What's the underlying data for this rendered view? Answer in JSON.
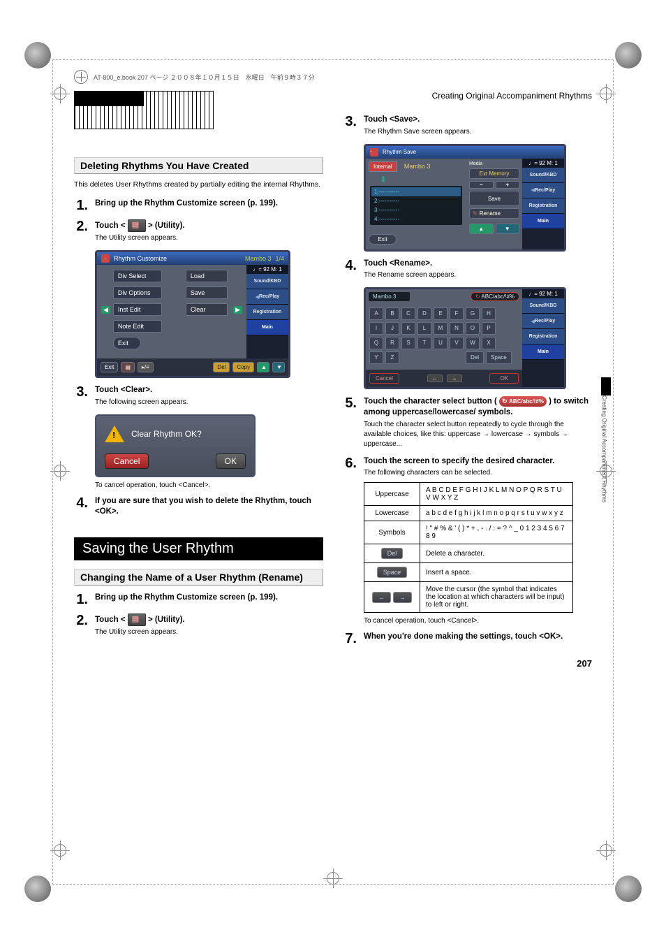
{
  "book_header": "AT-800_e.book  207 ページ  ２００８年１０月１５日　水曜日　午前９時３７分",
  "page_title_right": "Creating Original Accompaniment Rhythms",
  "side_text": "Creating Original Accompaniment Rhythms",
  "page_number": "207",
  "left": {
    "section_bar": "Deleting Rhythms You Have Created",
    "intro": "This deletes User Rhythms created by partially editing the internal Rhythms.",
    "steps": {
      "s1": "Bring up the Rhythm Customize screen (p. 199).",
      "s2_pre": "Touch <",
      "s2_post": "> (Utility).",
      "s2_sub": "The Utility screen appears.",
      "s3": "Touch <Clear>.",
      "s3_sub": "The following screen appears.",
      "cap3": "To cancel operation, touch <Cancel>.",
      "s4": "If you are sure that you wish to delete the Rhythm, touch <OK>."
    },
    "ui": {
      "title": "Rhythm Customize",
      "sub1": "Mambo 3",
      "sub2": "1/4",
      "opts_left": [
        "Div Select",
        "Div Options",
        "Inst Edit",
        "Note Edit"
      ],
      "opts_right": [
        "Load",
        "Save",
        "Clear"
      ],
      "exit_small": "Exit",
      "tempo": "♩= 92  M: 1",
      "rbtns": [
        "Sound/KBD",
        "Rec/Play",
        "Registration",
        "Main"
      ],
      "bottom": {
        "exit": "Exit",
        "del": "Del",
        "copy": "Copy",
        "frac": "▸/≡"
      }
    },
    "dialog": {
      "text": "Clear Rhythm OK?",
      "cancel": "Cancel",
      "ok": "OK"
    },
    "big_section": "Saving the User Rhythm",
    "section_bar2": "Changing the Name of a User Rhythm (Rename)",
    "steps2": {
      "s1": "Bring up the Rhythm Customize screen (p. 199).",
      "s2_pre": "Touch <",
      "s2_post": "> (Utility).",
      "s2_sub": "The Utility screen appears."
    }
  },
  "right": {
    "steps": {
      "s3": "Touch <Save>.",
      "s3_sub": "The Rhythm Save screen appears.",
      "s4": "Touch <Rename>.",
      "s4_sub": "The Rename screen appears.",
      "s5_pre": "Touch the character select button (",
      "s5_label": "ABC/abc/!#%",
      "s5_post": ") to switch among uppercase/lowercase/ symbols.",
      "s5_sub": "Touch the character select button repeatedly to cycle through the available choices, like this: uppercase → lowercase → symbols → uppercase...",
      "s6": "Touch the screen to specify the desired character.",
      "s6_sub": "The following characters can be selected.",
      "cap6": "To cancel operation, touch <Cancel>.",
      "s7": "When you're done making the settings, touch <OK>."
    },
    "save_ui": {
      "title": "Rhythm Save",
      "internal": "Internal",
      "rname": "Mambo 3",
      "media": "Media",
      "mediaval": "Ext Memory",
      "slots": [
        "1:-----------",
        "2:-----------",
        "3:-----------",
        "4:-----------"
      ],
      "save": "Save",
      "rename": "Rename",
      "exit": "Exit",
      "tempo": "♩= 92  M: 1",
      "rbtns": [
        "Sound/KBD",
        "Rec/Play",
        "Registration",
        "Main"
      ]
    },
    "kb": {
      "name": "Mambo 3",
      "mode": "ABC/abc/!#%",
      "rows": [
        [
          "A",
          "B",
          "C",
          "D",
          "E",
          "F",
          "G",
          "H"
        ],
        [
          "I",
          "J",
          "K",
          "L",
          "M",
          "N",
          "O",
          "P"
        ],
        [
          "Q",
          "R",
          "S",
          "T",
          "U",
          "V",
          "W",
          "X"
        ],
        [
          "Y",
          "Z",
          "",
          "",
          "",
          "",
          "Del",
          "Space"
        ]
      ],
      "cancel": "Cancel",
      "ok": "OK",
      "tempo": "♩= 92  M: 1",
      "rbtns": [
        "Sound/KBD",
        "Rec/Play",
        "Registration",
        "Main"
      ]
    },
    "chartable": {
      "rows": [
        {
          "k": "Uppercase",
          "v": "A B C D E F G H I J K L M N O P Q R S T U V W X Y Z"
        },
        {
          "k": "Lowercase",
          "v": "a b c d e f g h i j k l m n o p q r s t u v w x y z"
        },
        {
          "k": "Symbols",
          "v": "! \" # % & ' ( ) * + , - . / : = ? ^ _ 0 1 2 3 4 5 6 7 8 9"
        }
      ],
      "del": {
        "k": "Del",
        "v": "Delete a character."
      },
      "space": {
        "k": "Space",
        "v": "Insert a space."
      },
      "arrows": {
        "v": "Move the cursor (the symbol that indicates the location at which characters will be input) to left or right."
      }
    }
  }
}
